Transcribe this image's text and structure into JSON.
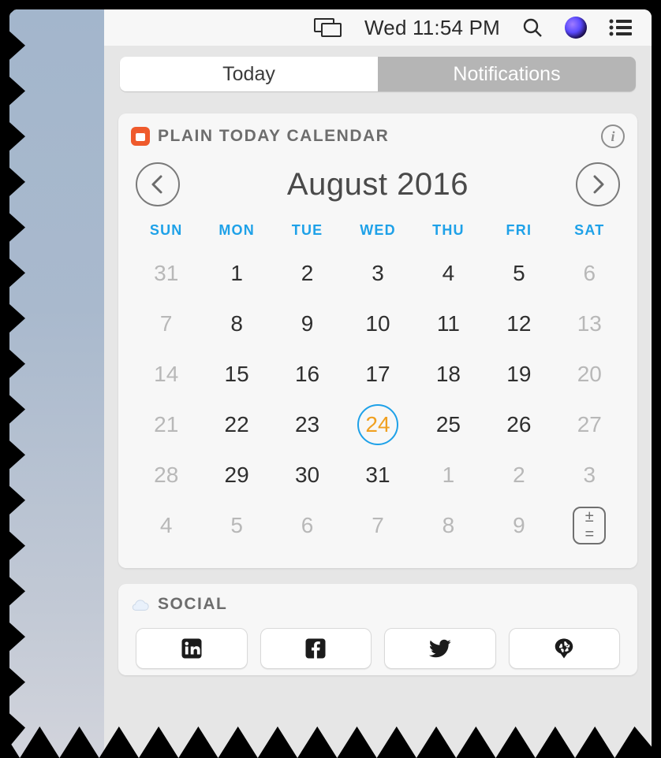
{
  "menubar": {
    "datetime": "Wed 11:54 PM"
  },
  "tabs": {
    "today": "Today",
    "notifications": "Notifications",
    "active": "Today"
  },
  "calendar": {
    "widget_title": "PLAIN TODAY CALENDAR",
    "info_label": "i",
    "month_label": "August 2016",
    "dow": [
      "SUN",
      "MON",
      "TUE",
      "WED",
      "THU",
      "FRI",
      "SAT"
    ],
    "today": 24,
    "weeks": [
      [
        {
          "d": "31",
          "out": true
        },
        {
          "d": "1"
        },
        {
          "d": "2"
        },
        {
          "d": "3"
        },
        {
          "d": "4"
        },
        {
          "d": "5"
        },
        {
          "d": "6",
          "out": true
        }
      ],
      [
        {
          "d": "7",
          "out": true
        },
        {
          "d": "8"
        },
        {
          "d": "9"
        },
        {
          "d": "10"
        },
        {
          "d": "11"
        },
        {
          "d": "12"
        },
        {
          "d": "13",
          "out": true
        }
      ],
      [
        {
          "d": "14",
          "out": true
        },
        {
          "d": "15"
        },
        {
          "d": "16"
        },
        {
          "d": "17"
        },
        {
          "d": "18"
        },
        {
          "d": "19"
        },
        {
          "d": "20",
          "out": true
        }
      ],
      [
        {
          "d": "21",
          "out": true
        },
        {
          "d": "22"
        },
        {
          "d": "23"
        },
        {
          "d": "24",
          "today": true
        },
        {
          "d": "25"
        },
        {
          "d": "26"
        },
        {
          "d": "27",
          "out": true
        }
      ],
      [
        {
          "d": "28",
          "out": true
        },
        {
          "d": "29"
        },
        {
          "d": "30"
        },
        {
          "d": "31"
        },
        {
          "d": "1",
          "out": true
        },
        {
          "d": "2",
          "out": true
        },
        {
          "d": "3",
          "out": true
        }
      ],
      [
        {
          "d": "4",
          "out": true
        },
        {
          "d": "5",
          "out": true
        },
        {
          "d": "6",
          "out": true
        },
        {
          "d": "7",
          "out": true
        },
        {
          "d": "8",
          "out": true
        },
        {
          "d": "9",
          "out": true
        },
        {
          "d": "events",
          "events_btn": true
        }
      ]
    ],
    "events_btn": {
      "line1": "±",
      "line2": "="
    }
  },
  "social": {
    "widget_title": "SOCIAL",
    "buttons": [
      "linkedin",
      "facebook",
      "twitter",
      "yelp"
    ]
  }
}
